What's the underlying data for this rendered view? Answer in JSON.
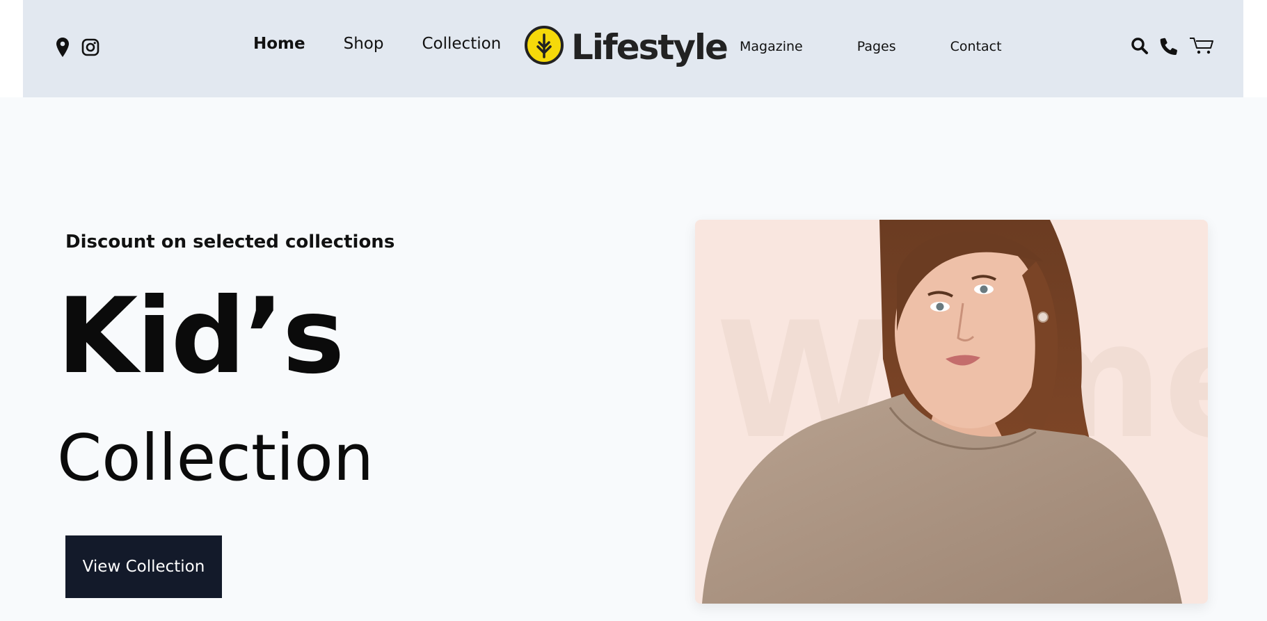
{
  "header": {
    "left_icons": [
      "location-pin-icon",
      "instagram-icon"
    ],
    "nav_left": [
      {
        "label": "Home",
        "active": true
      },
      {
        "label": "Shop",
        "active": false
      },
      {
        "label": "Collection",
        "active": false
      }
    ],
    "logo": {
      "text": "Lifestyle",
      "icon": "tree-leaf-icon",
      "accent": "#f5d90a"
    },
    "nav_right": [
      {
        "label": "Magazine"
      },
      {
        "label": "Pages"
      },
      {
        "label": "Contact"
      }
    ],
    "right_icons": [
      "search-icon",
      "phone-icon",
      "cart-icon"
    ],
    "background": "#e2e8f0"
  },
  "hero": {
    "subtitle": "Discount on selected collections",
    "title_line1": "Kid’s",
    "title_line2": "Collection",
    "cta_label": "View Collection",
    "cta_color": "#131a2a",
    "image": {
      "background_text": "Women",
      "background_color": "#f9e6df"
    },
    "background": "#f8fafc"
  }
}
